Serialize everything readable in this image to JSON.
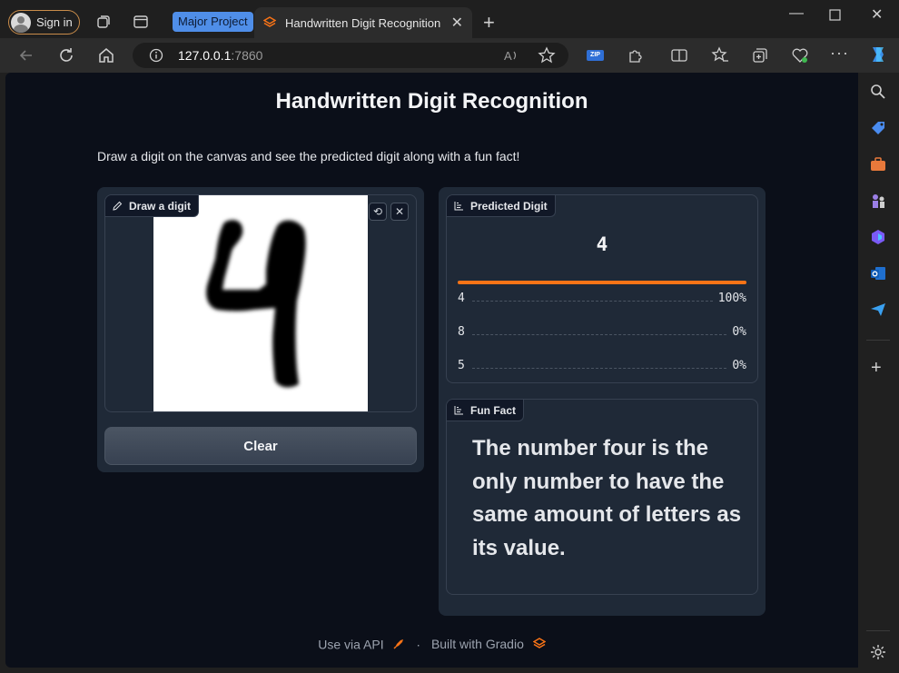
{
  "browser": {
    "sign_in": "Sign in",
    "tab_group": "Major Project",
    "tab_title": "Handwritten Digit Recognition",
    "url_host": "127.0.0.1",
    "url_port": ":7860",
    "zip_badge": "ZIP"
  },
  "app": {
    "title": "Handwritten Digit Recognition",
    "description": "Draw a digit on the canvas and see the predicted digit along with a fun fact!",
    "sketch_label": "Draw a digit",
    "drawn_digit": "4",
    "clear_label": "Clear",
    "prediction_label": "Predicted Digit",
    "predicted_value": "4",
    "top_confidence": 1.0,
    "confidences": [
      {
        "label": "4",
        "value": "100%"
      },
      {
        "label": "8",
        "value": "0%"
      },
      {
        "label": "5",
        "value": "0%"
      }
    ],
    "fun_fact_label": "Fun Fact",
    "fun_fact": "The number four is the only number to have the same amount of letters as its value."
  },
  "footer": {
    "api": "Use via API",
    "separator": "·",
    "built": "Built with Gradio"
  },
  "colors": {
    "accent": "#f97316",
    "page_bg": "#0b0f19",
    "panel_bg": "#1f2937",
    "tab_group": "#4f8ee8"
  }
}
